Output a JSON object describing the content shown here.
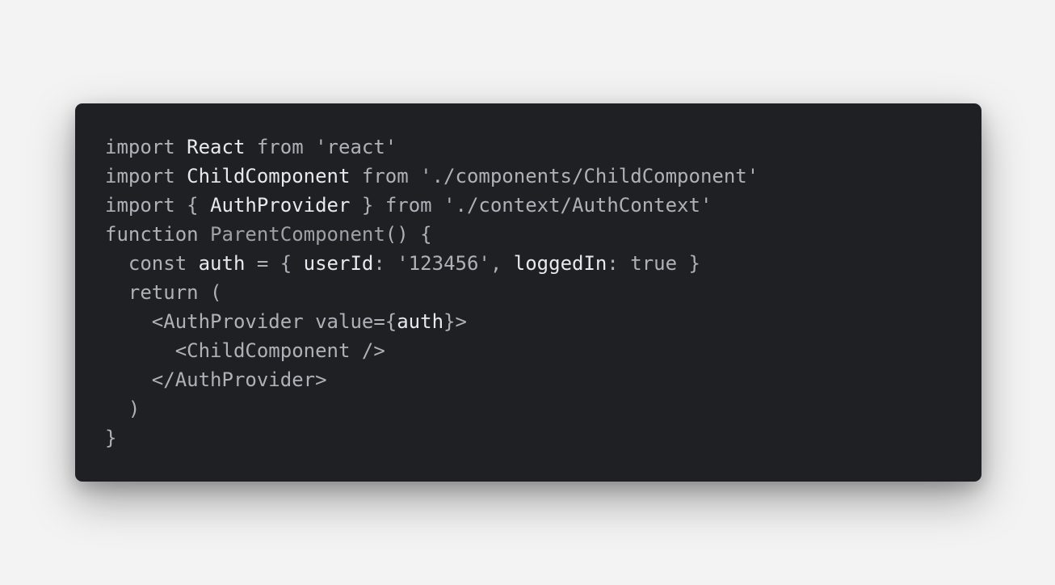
{
  "code": {
    "colors": {
      "background": "#1e2024",
      "page": "#f3f3f3",
      "default": "#aeb2b8",
      "identifier": "#e7e9ec",
      "muted": "#9ea2a8"
    },
    "lines": [
      {
        "indent": "",
        "tokens": [
          {
            "text": "import ",
            "kind": "default"
          },
          {
            "text": "React",
            "kind": "identifier"
          },
          {
            "text": " from ",
            "kind": "default"
          },
          {
            "text": "'react'",
            "kind": "default"
          }
        ]
      },
      {
        "indent": "",
        "tokens": [
          {
            "text": "import ",
            "kind": "default"
          },
          {
            "text": "ChildComponent",
            "kind": "identifier"
          },
          {
            "text": " from ",
            "kind": "default"
          },
          {
            "text": "'./components/ChildComponent'",
            "kind": "default"
          }
        ]
      },
      {
        "indent": "",
        "tokens": [
          {
            "text": "import ",
            "kind": "default"
          },
          {
            "text": "{ ",
            "kind": "default"
          },
          {
            "text": "AuthProvider",
            "kind": "identifier"
          },
          {
            "text": " } ",
            "kind": "default"
          },
          {
            "text": "from ",
            "kind": "default"
          },
          {
            "text": "'./context/AuthContext'",
            "kind": "default"
          }
        ]
      },
      {
        "indent": "",
        "tokens": [
          {
            "text": "function ",
            "kind": "default"
          },
          {
            "text": "ParentComponent",
            "kind": "muted"
          },
          {
            "text": "() {",
            "kind": "default"
          }
        ]
      },
      {
        "indent": "  ",
        "tokens": [
          {
            "text": "const ",
            "kind": "default"
          },
          {
            "text": "auth",
            "kind": "identifier"
          },
          {
            "text": " = { ",
            "kind": "default"
          },
          {
            "text": "userId",
            "kind": "identifier"
          },
          {
            "text": ": ",
            "kind": "default"
          },
          {
            "text": "'123456'",
            "kind": "default"
          },
          {
            "text": ", ",
            "kind": "default"
          },
          {
            "text": "loggedIn",
            "kind": "identifier"
          },
          {
            "text": ": ",
            "kind": "default"
          },
          {
            "text": "true",
            "kind": "default"
          },
          {
            "text": " }",
            "kind": "default"
          }
        ]
      },
      {
        "indent": "  ",
        "tokens": [
          {
            "text": "return (",
            "kind": "default"
          }
        ]
      },
      {
        "indent": "    ",
        "tokens": [
          {
            "text": "<",
            "kind": "default"
          },
          {
            "text": "AuthProvider",
            "kind": "default"
          },
          {
            "text": " value={",
            "kind": "default"
          },
          {
            "text": "auth",
            "kind": "identifier"
          },
          {
            "text": "}>",
            "kind": "default"
          }
        ]
      },
      {
        "indent": "      ",
        "tokens": [
          {
            "text": "<ChildComponent />",
            "kind": "default"
          }
        ]
      },
      {
        "indent": "    ",
        "tokens": [
          {
            "text": "</AuthProvider>",
            "kind": "default"
          }
        ]
      },
      {
        "indent": "  ",
        "tokens": [
          {
            "text": ")",
            "kind": "default"
          }
        ]
      },
      {
        "indent": "",
        "tokens": [
          {
            "text": "}",
            "kind": "default"
          }
        ]
      }
    ]
  }
}
